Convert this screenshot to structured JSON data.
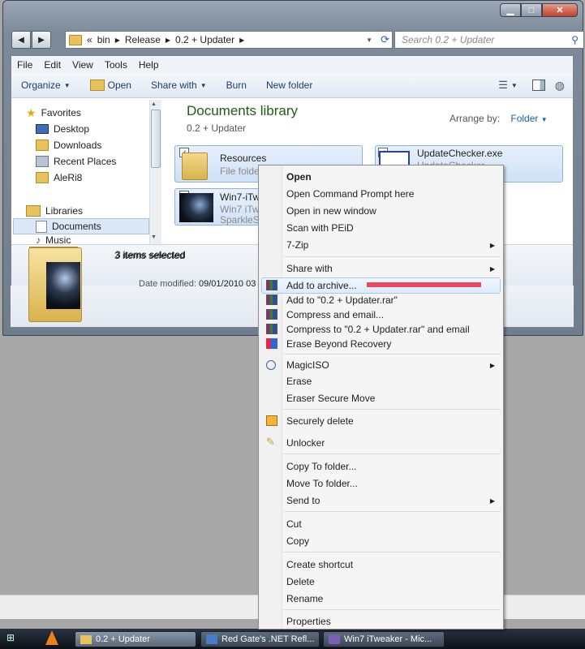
{
  "window": {
    "caption_buttons": {
      "minimize": "▁",
      "maximize": "□",
      "close": "✕"
    },
    "address": {
      "prefix": "«",
      "segments": [
        "bin",
        "Release",
        "0.2 + Updater"
      ]
    },
    "search_placeholder": "Search 0.2 + Updater",
    "menubar": [
      "File",
      "Edit",
      "View",
      "Tools",
      "Help"
    ],
    "toolbar": {
      "organize": "Organize",
      "open": "Open",
      "share_with": "Share with",
      "burn": "Burn",
      "new_folder": "New folder"
    },
    "sidebar": {
      "favorites": "Favorites",
      "desktop": "Desktop",
      "downloads": "Downloads",
      "recent_places": "Recent Places",
      "user": "AleRi8",
      "libraries": "Libraries",
      "documents": "Documents",
      "music": "Music"
    },
    "library": {
      "title": "Documents library",
      "subtitle": "0.2 + Updater",
      "arrange_label": "Arrange by:",
      "arrange_value": "Folder"
    },
    "files": [
      {
        "name": "Resources",
        "sub": "File folder"
      },
      {
        "name": "UpdateChecker.exe",
        "sub": "UpdateChecker"
      },
      {
        "name": "Win7-iTw",
        "sub": "Win7 iTwe",
        "sub2": "SparkleSof"
      }
    ],
    "details": {
      "selected": "3 items selected",
      "date_label": "Date modified:",
      "date_value": "09/01/2010 03"
    }
  },
  "context_menu": {
    "open": "Open",
    "open_cmd": "Open Command Prompt here",
    "open_new": "Open in new window",
    "scan": "Scan with PEiD",
    "zip": "7-Zip",
    "share_with": "Share with",
    "add_archive": "Add to archive...",
    "add_rar": "Add to \"0.2 + Updater.rar\"",
    "compress_email": "Compress and email...",
    "compress_rar_email": "Compress to \"0.2 + Updater.rar\" and email",
    "erase_beyond": "Erase Beyond Recovery",
    "magiciso": "MagicISO",
    "erase": "Erase",
    "eraser_move": "Eraser Secure Move",
    "secure_delete": "Securely delete",
    "unlocker": "Unlocker",
    "copy_to": "Copy To folder...",
    "move_to": "Move To folder...",
    "send_to": "Send to",
    "cut": "Cut",
    "copy": "Copy",
    "create_shortcut": "Create shortcut",
    "delete": "Delete",
    "rename": "Rename",
    "properties": "Properties"
  },
  "taskbar": {
    "items": [
      "0.2 + Updater",
      "Red Gate's .NET Refl...",
      "Win7 iTweaker - Mic..."
    ]
  },
  "colors": {
    "highlight_bar": "#e64c5e",
    "library_title": "#1e5d14",
    "link_blue": "#1d5fb0"
  }
}
